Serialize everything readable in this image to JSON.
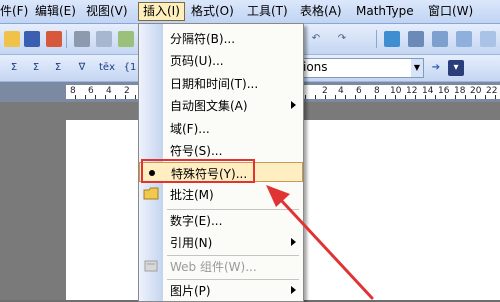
{
  "menubar": {
    "items": [
      {
        "label": "件(F)"
      },
      {
        "label": "编辑(E)"
      },
      {
        "label": "视图(V)"
      },
      {
        "label": "插入(I)"
      },
      {
        "label": "格式(O)"
      },
      {
        "label": "工具(T)"
      },
      {
        "label": "表格(A)"
      },
      {
        "label": "MathType"
      },
      {
        "label": "窗口(W)"
      }
    ],
    "active_item": "插入(I)"
  },
  "toolbar": {
    "style_combo_value": "ions",
    "icons": [
      "open-icon",
      "save-icon",
      "permission-icon",
      "print-icon",
      "print-preview-icon",
      "spelling-icon",
      "undo-icon",
      "redo-icon",
      "hyperlink-icon",
      "tables-icon",
      "insert-table-icon",
      "columns-icon"
    ],
    "row2_glyphs": [
      "Σ",
      "Σ",
      "Σ",
      "∇",
      "tēx",
      "{1"
    ]
  },
  "ruler": {
    "numbers": [
      "8",
      "6",
      "4",
      "2",
      "",
      "2",
      "4",
      "6",
      "8",
      "10",
      "12",
      "14",
      "16",
      "18",
      "20",
      "22"
    ]
  },
  "insert_menu": {
    "items": [
      {
        "label": "分隔符(B)...",
        "submenu": false,
        "disabled": false,
        "icon": ""
      },
      {
        "label": "页码(U)...",
        "submenu": false,
        "disabled": false,
        "icon": ""
      },
      {
        "label": "日期和时间(T)...",
        "submenu": false,
        "disabled": false,
        "icon": ""
      },
      {
        "label": "自动图文集(A)",
        "submenu": true,
        "disabled": false,
        "icon": ""
      },
      {
        "label": "域(F)...",
        "submenu": false,
        "disabled": false,
        "icon": ""
      },
      {
        "label": "符号(S)...",
        "submenu": false,
        "disabled": false,
        "icon": ""
      },
      {
        "label": "特殊符号(Y)...",
        "submenu": false,
        "disabled": false,
        "icon": "special-symbol-icon",
        "highlighted": true
      },
      {
        "label": "批注(M)",
        "submenu": false,
        "disabled": false,
        "icon": "comment-icon"
      },
      {
        "label": "数字(E)...",
        "submenu": false,
        "disabled": false,
        "icon": ""
      },
      {
        "label": "引用(N)",
        "submenu": true,
        "disabled": false,
        "icon": ""
      },
      {
        "label": "Web 组件(W)...",
        "submenu": false,
        "disabled": true,
        "icon": "web-component-icon"
      },
      {
        "label": "图片(P)",
        "submenu": true,
        "disabled": false,
        "icon": ""
      }
    ]
  },
  "colors": {
    "annotation_red": "#e03434",
    "menu_highlight": "#ffeec2",
    "menubar": "#c1d4f3"
  }
}
